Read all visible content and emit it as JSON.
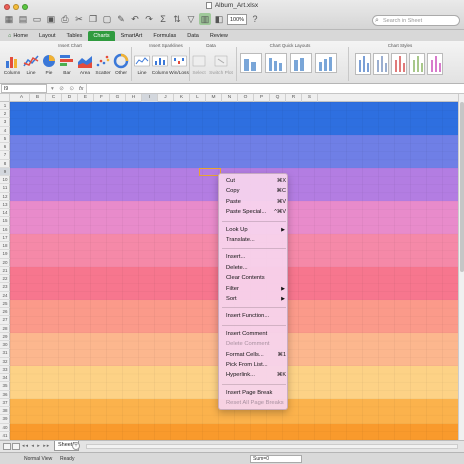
{
  "window": {
    "title": "Album_Art.xlsx"
  },
  "quick_access": {
    "zoom": "100%"
  },
  "search": {
    "placeholder": "Search in Sheet"
  },
  "ribbon": {
    "tabs": [
      "Home",
      "Layout",
      "Tables",
      "Charts",
      "SmartArt",
      "Formulas",
      "Data",
      "Review"
    ],
    "active_tab": "Charts",
    "groups": [
      "Insert Chart",
      "Insert Sparklines",
      "Data",
      "Chart Quick Layouts",
      "Chart Styles"
    ],
    "chart_buttons": [
      "Column",
      "Line",
      "Pie",
      "Bar",
      "Area",
      "Scatter",
      "Other"
    ],
    "sparkline_buttons": [
      "Line",
      "Column",
      "Win/Loss"
    ],
    "data_buttons": [
      "Select",
      "Switch Plot"
    ]
  },
  "formula_bar": {
    "name_box": "I9",
    "fx": "fx"
  },
  "columns": [
    "A",
    "B",
    "C",
    "D",
    "E",
    "F",
    "G",
    "H",
    "I",
    "J",
    "K",
    "L",
    "M",
    "N",
    "O",
    "P",
    "Q",
    "R",
    "S"
  ],
  "selected_column": "I",
  "selected_row": "9",
  "rows": [
    "1",
    "2",
    "3",
    "4",
    "5",
    "6",
    "7",
    "8",
    "9",
    "10",
    "11",
    "12",
    "13",
    "14",
    "15",
    "16",
    "17",
    "18",
    "19",
    "20",
    "21",
    "22",
    "23",
    "24",
    "25",
    "26",
    "27",
    "28",
    "29",
    "30",
    "31",
    "32",
    "33",
    "34",
    "35",
    "36",
    "37",
    "38",
    "39",
    "40",
    "41"
  ],
  "bands": [
    {
      "rows": 4,
      "color": "#2e6fe0"
    },
    {
      "rows": 4,
      "color": "#6f7fe6"
    },
    {
      "rows": 4,
      "color": "#b37de2"
    },
    {
      "rows": 4,
      "color": "#e88bcb"
    },
    {
      "rows": 4,
      "color": "#f589a8"
    },
    {
      "rows": 4,
      "color": "#f7768e"
    },
    {
      "rows": 4,
      "color": "#fb9a8a"
    },
    {
      "rows": 4,
      "color": "#fcb78e"
    },
    {
      "rows": 4,
      "color": "#fdd286"
    },
    {
      "rows": 3,
      "color": "#fbb24c"
    },
    {
      "rows": 2,
      "color": "#f99a2c"
    }
  ],
  "context_menu": {
    "items": [
      {
        "label": "Cut",
        "shortcut": "⌘X"
      },
      {
        "label": "Copy",
        "shortcut": "⌘C"
      },
      {
        "label": "Paste",
        "shortcut": "⌘V"
      },
      {
        "label": "Paste Special...",
        "shortcut": "^⌘V"
      },
      {
        "sep": true
      },
      {
        "label": "Look Up",
        "submenu": true
      },
      {
        "label": "Translate..."
      },
      {
        "sep": true
      },
      {
        "label": "Insert..."
      },
      {
        "label": "Delete..."
      },
      {
        "label": "Clear Contents"
      },
      {
        "label": "Filter",
        "submenu": true
      },
      {
        "label": "Sort",
        "submenu": true
      },
      {
        "sep": true
      },
      {
        "label": "Insert Function..."
      },
      {
        "sep": true
      },
      {
        "label": "Insert Comment"
      },
      {
        "label": "Delete Comment",
        "disabled": true
      },
      {
        "label": "Format Cells...",
        "shortcut": "⌘1"
      },
      {
        "label": "Pick From List..."
      },
      {
        "label": "Hyperlink...",
        "shortcut": "⌘K"
      },
      {
        "sep": true
      },
      {
        "label": "Insert Page Break"
      },
      {
        "label": "Reset All Page Breaks",
        "disabled": true
      }
    ]
  },
  "sheet_tabs": {
    "active": "Sheet1",
    "add": "+"
  },
  "status_bar": {
    "view": "Normal View",
    "state": "Ready",
    "sum": "Sum=0"
  },
  "colors": {
    "accent": "#2f9b3f",
    "selection_border": "#e8a530"
  }
}
